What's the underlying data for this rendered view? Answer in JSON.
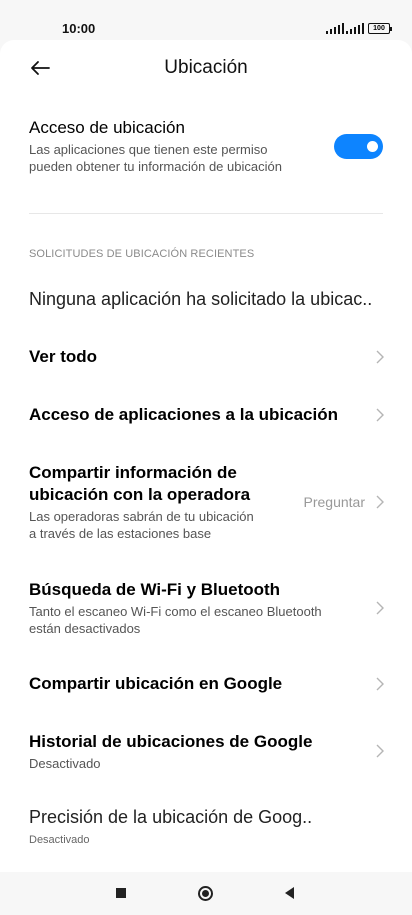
{
  "status_bar": {
    "time": "10:00",
    "battery": "100"
  },
  "header": {
    "title": "Ubicación"
  },
  "location_access": {
    "title": "Acceso de ubicación",
    "description_line1": "Las aplicaciones que tienen este permiso",
    "description_line2": "pueden obtener tu información de ubicación",
    "enabled": true
  },
  "recent_requests": {
    "section_title": "SOLICITUDES DE UBICACIÓN RECIENTES",
    "empty_text": "Ninguna aplicación ha solicitado la ubicac.."
  },
  "items": {
    "see_all": {
      "title": "Ver todo"
    },
    "app_access": {
      "title": "Acceso de aplicaciones a la ubicación"
    },
    "share_carrier": {
      "title_line1": "Compartir información de",
      "title_line2": "ubicación con la operadora",
      "description_line1": "Las operadoras sabrán de tu ubicación",
      "description_line2": "a través de las estaciones base",
      "value": "Preguntar"
    },
    "wifi_bt_scan": {
      "title": "Búsqueda de Wi-Fi y Bluetooth",
      "description_line1": "Tanto el escaneo Wi-Fi como el escaneo Bluetooth",
      "description_line2": "están desactivados"
    },
    "google_share": {
      "title": "Compartir ubicación en Google"
    },
    "google_history": {
      "title": "Historial de ubicaciones de Google",
      "description": "Desactivado"
    },
    "google_accuracy": {
      "title": "Precisión de la ubicación de Goog..",
      "description": "Desactivado"
    }
  },
  "colors": {
    "accent": "#0d84ff",
    "background": "#ffffff",
    "secondary_text": "#555555"
  }
}
